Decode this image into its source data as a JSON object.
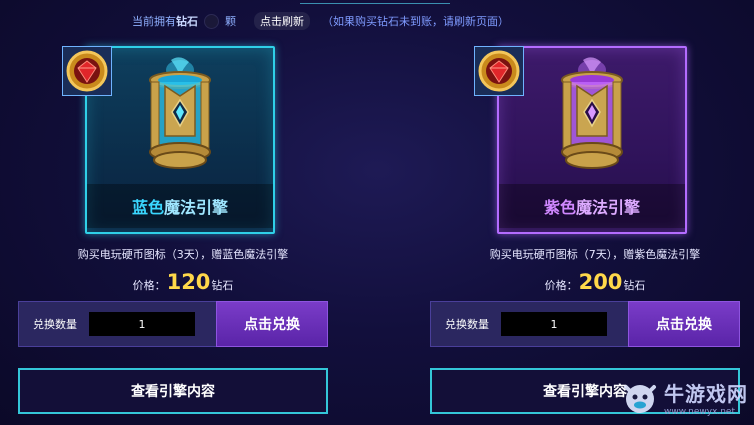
{
  "topbar": {
    "owned_prefix": "当前拥有",
    "owned_currency": "钻石",
    "owned_unit": "颗",
    "refresh_label": "点击刷新",
    "note": "（如果购买钻石未到账，请刷新页面）"
  },
  "products": [
    {
      "name_part1": "蓝色",
      "name_part2": "魔法引擎",
      "description": "购买电玩硬币图标（3天），赠蓝色魔法引擎",
      "price_label": "价格：",
      "price_value": "120",
      "price_currency": "钻石",
      "qty_label": "兑换数量",
      "qty_value": "1",
      "exchange_label": "点击兑换",
      "view_label": "查看引擎内容",
      "accent_color": "#2fd0e8",
      "theme": "blue"
    },
    {
      "name_part1": "紫色",
      "name_part2": "魔法引擎",
      "description": "购买电玩硬币图标（7天），赠紫色魔法引擎",
      "price_label": "价格：",
      "price_value": "200",
      "price_currency": "钻石",
      "qty_label": "兑换数量",
      "qty_value": "1",
      "exchange_label": "点击兑换",
      "view_label": "查看引擎内容",
      "accent_color": "#b46cff",
      "theme": "purple"
    }
  ],
  "watermark": {
    "title": "牛游戏网",
    "url": "www.newyx.net"
  },
  "icons": {
    "diamond_badge": "diamond-gem-icon",
    "engine": "magic-engine-icon",
    "watermark_logo": "cow-logo-icon"
  }
}
